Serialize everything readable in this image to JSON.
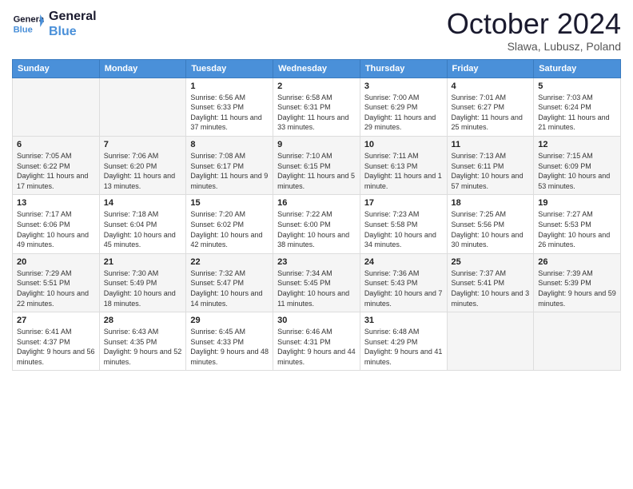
{
  "logo": {
    "text_general": "General",
    "text_blue": "Blue"
  },
  "header": {
    "month": "October 2024",
    "location": "Slawa, Lubusz, Poland"
  },
  "weekdays": [
    "Sunday",
    "Monday",
    "Tuesday",
    "Wednesday",
    "Thursday",
    "Friday",
    "Saturday"
  ],
  "weeks": [
    [
      {
        "day": "",
        "info": ""
      },
      {
        "day": "",
        "info": ""
      },
      {
        "day": "1",
        "info": "Sunrise: 6:56 AM\nSunset: 6:33 PM\nDaylight: 11 hours and 37 minutes."
      },
      {
        "day": "2",
        "info": "Sunrise: 6:58 AM\nSunset: 6:31 PM\nDaylight: 11 hours and 33 minutes."
      },
      {
        "day": "3",
        "info": "Sunrise: 7:00 AM\nSunset: 6:29 PM\nDaylight: 11 hours and 29 minutes."
      },
      {
        "day": "4",
        "info": "Sunrise: 7:01 AM\nSunset: 6:27 PM\nDaylight: 11 hours and 25 minutes."
      },
      {
        "day": "5",
        "info": "Sunrise: 7:03 AM\nSunset: 6:24 PM\nDaylight: 11 hours and 21 minutes."
      }
    ],
    [
      {
        "day": "6",
        "info": "Sunrise: 7:05 AM\nSunset: 6:22 PM\nDaylight: 11 hours and 17 minutes."
      },
      {
        "day": "7",
        "info": "Sunrise: 7:06 AM\nSunset: 6:20 PM\nDaylight: 11 hours and 13 minutes."
      },
      {
        "day": "8",
        "info": "Sunrise: 7:08 AM\nSunset: 6:17 PM\nDaylight: 11 hours and 9 minutes."
      },
      {
        "day": "9",
        "info": "Sunrise: 7:10 AM\nSunset: 6:15 PM\nDaylight: 11 hours and 5 minutes."
      },
      {
        "day": "10",
        "info": "Sunrise: 7:11 AM\nSunset: 6:13 PM\nDaylight: 11 hours and 1 minute."
      },
      {
        "day": "11",
        "info": "Sunrise: 7:13 AM\nSunset: 6:11 PM\nDaylight: 10 hours and 57 minutes."
      },
      {
        "day": "12",
        "info": "Sunrise: 7:15 AM\nSunset: 6:09 PM\nDaylight: 10 hours and 53 minutes."
      }
    ],
    [
      {
        "day": "13",
        "info": "Sunrise: 7:17 AM\nSunset: 6:06 PM\nDaylight: 10 hours and 49 minutes."
      },
      {
        "day": "14",
        "info": "Sunrise: 7:18 AM\nSunset: 6:04 PM\nDaylight: 10 hours and 45 minutes."
      },
      {
        "day": "15",
        "info": "Sunrise: 7:20 AM\nSunset: 6:02 PM\nDaylight: 10 hours and 42 minutes."
      },
      {
        "day": "16",
        "info": "Sunrise: 7:22 AM\nSunset: 6:00 PM\nDaylight: 10 hours and 38 minutes."
      },
      {
        "day": "17",
        "info": "Sunrise: 7:23 AM\nSunset: 5:58 PM\nDaylight: 10 hours and 34 minutes."
      },
      {
        "day": "18",
        "info": "Sunrise: 7:25 AM\nSunset: 5:56 PM\nDaylight: 10 hours and 30 minutes."
      },
      {
        "day": "19",
        "info": "Sunrise: 7:27 AM\nSunset: 5:53 PM\nDaylight: 10 hours and 26 minutes."
      }
    ],
    [
      {
        "day": "20",
        "info": "Sunrise: 7:29 AM\nSunset: 5:51 PM\nDaylight: 10 hours and 22 minutes."
      },
      {
        "day": "21",
        "info": "Sunrise: 7:30 AM\nSunset: 5:49 PM\nDaylight: 10 hours and 18 minutes."
      },
      {
        "day": "22",
        "info": "Sunrise: 7:32 AM\nSunset: 5:47 PM\nDaylight: 10 hours and 14 minutes."
      },
      {
        "day": "23",
        "info": "Sunrise: 7:34 AM\nSunset: 5:45 PM\nDaylight: 10 hours and 11 minutes."
      },
      {
        "day": "24",
        "info": "Sunrise: 7:36 AM\nSunset: 5:43 PM\nDaylight: 10 hours and 7 minutes."
      },
      {
        "day": "25",
        "info": "Sunrise: 7:37 AM\nSunset: 5:41 PM\nDaylight: 10 hours and 3 minutes."
      },
      {
        "day": "26",
        "info": "Sunrise: 7:39 AM\nSunset: 5:39 PM\nDaylight: 9 hours and 59 minutes."
      }
    ],
    [
      {
        "day": "27",
        "info": "Sunrise: 6:41 AM\nSunset: 4:37 PM\nDaylight: 9 hours and 56 minutes."
      },
      {
        "day": "28",
        "info": "Sunrise: 6:43 AM\nSunset: 4:35 PM\nDaylight: 9 hours and 52 minutes."
      },
      {
        "day": "29",
        "info": "Sunrise: 6:45 AM\nSunset: 4:33 PM\nDaylight: 9 hours and 48 minutes."
      },
      {
        "day": "30",
        "info": "Sunrise: 6:46 AM\nSunset: 4:31 PM\nDaylight: 9 hours and 44 minutes."
      },
      {
        "day": "31",
        "info": "Sunrise: 6:48 AM\nSunset: 4:29 PM\nDaylight: 9 hours and 41 minutes."
      },
      {
        "day": "",
        "info": ""
      },
      {
        "day": "",
        "info": ""
      }
    ]
  ]
}
